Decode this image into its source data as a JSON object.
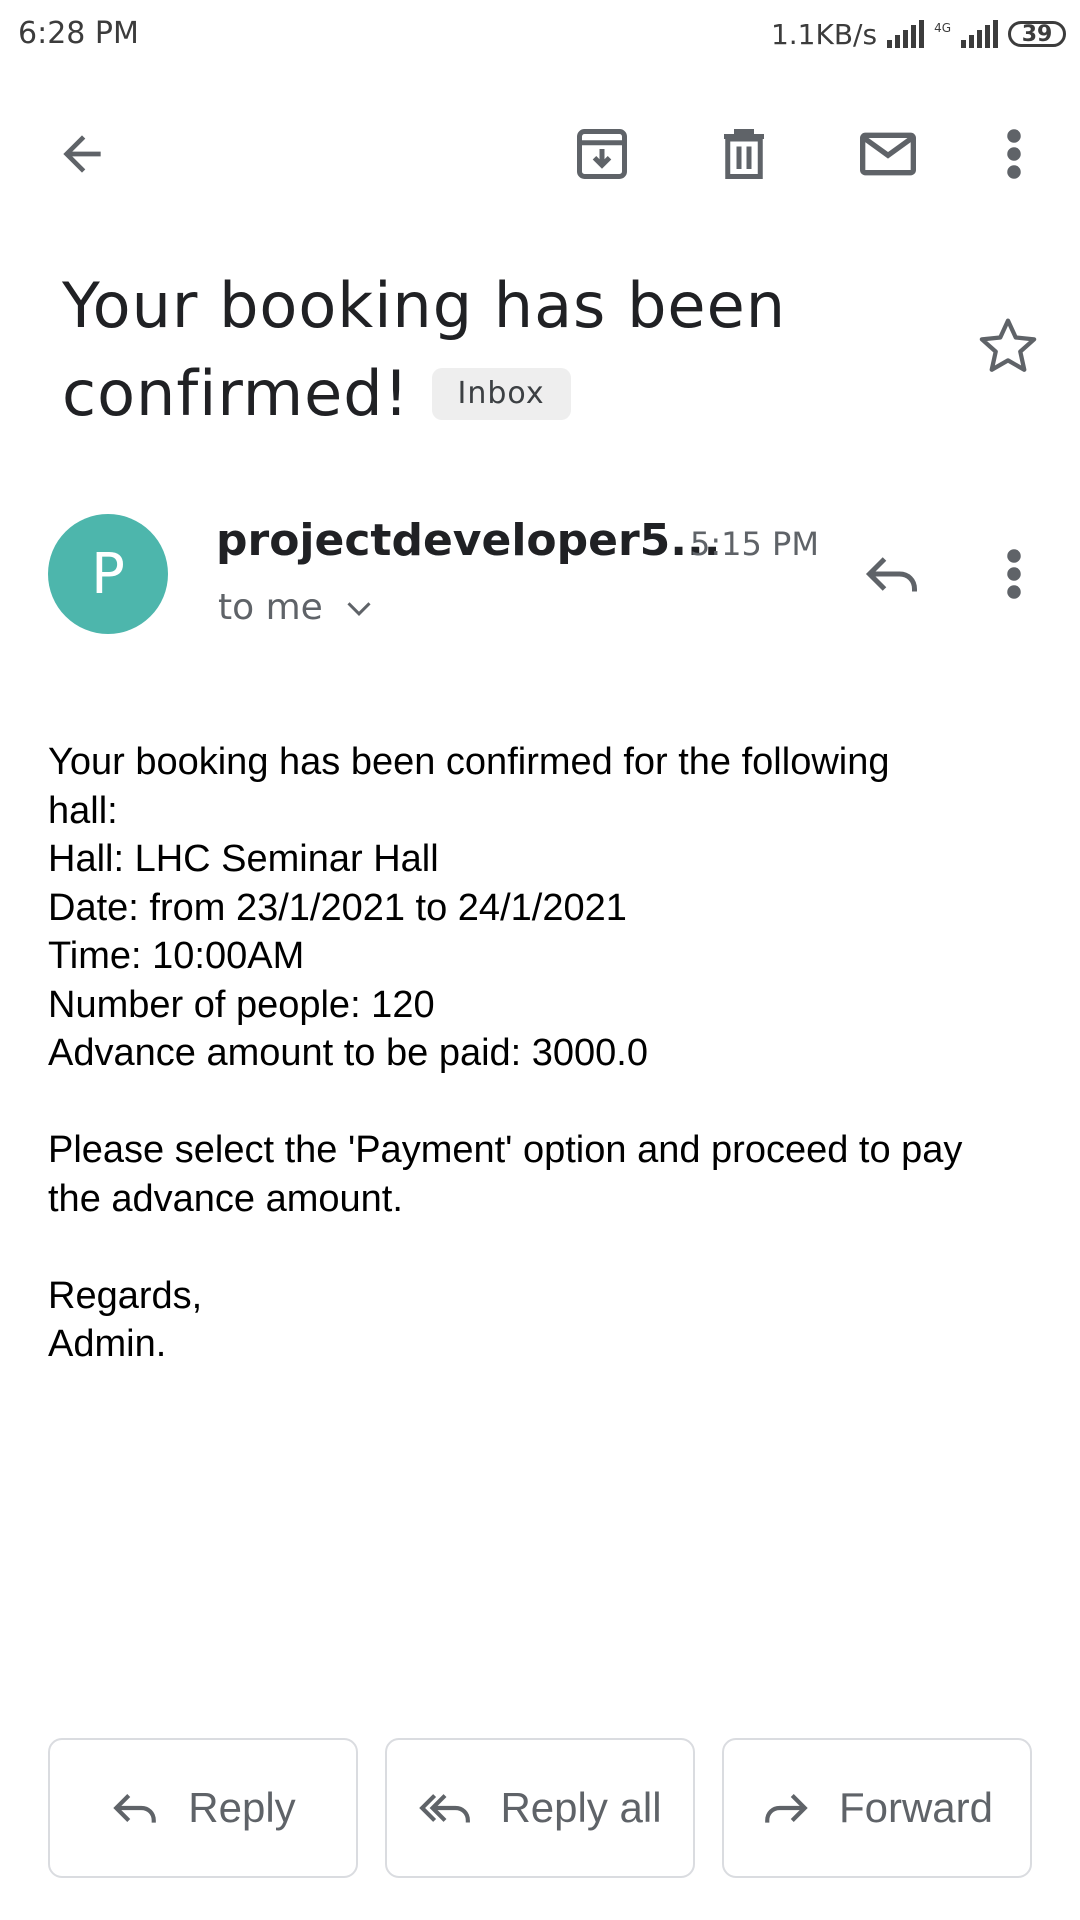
{
  "status_bar": {
    "time": "6:28 PM",
    "speed": "1.1KB/s",
    "network": "4G",
    "battery": "39"
  },
  "toolbar": {
    "back_icon": "arrow-back-icon",
    "archive_icon": "archive-icon",
    "delete_icon": "trash-icon",
    "mark_unread_icon": "mail-icon",
    "more_icon": "more-vert-icon"
  },
  "email": {
    "subject_line1": "Your booking has been",
    "subject_line2": "confirmed!",
    "label_chip": "Inbox",
    "sender_initial": "P",
    "sender_name": "projectdeveloper5...",
    "time": "5:15 PM",
    "recipient": "to me",
    "body_lines": [
      "Your booking has been confirmed for the following",
      "hall:",
      "Hall: LHC Seminar Hall",
      "Date: from 23/1/2021 to 24/1/2021",
      "Time: 10:00AM",
      "Number of people: 120",
      "Advance amount to be paid: 3000.0",
      "Please select the 'Payment' option and proceed to pay",
      "the advance amount.",
      "Regards,",
      "Admin."
    ]
  },
  "actions": {
    "reply": "Reply",
    "reply_all": "Reply all",
    "forward": "Forward"
  },
  "colors": {
    "avatar": "#4db6ac",
    "icon": "#5f6368"
  }
}
